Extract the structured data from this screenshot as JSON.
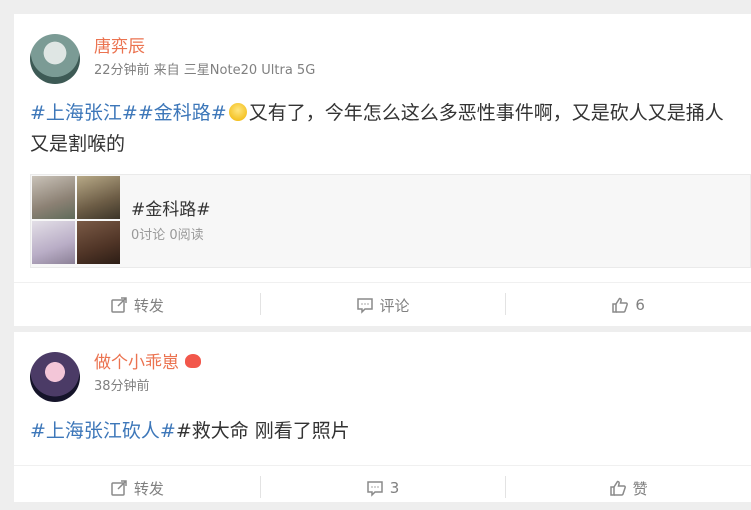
{
  "posts": [
    {
      "username": "唐弈辰",
      "meta": "22分钟前 来自 三星Note20 Ultra 5G",
      "text_parts": [
        "#上海张江#",
        "#金科路#",
        "又有了，今年怎么这么多恶性事件啊，又是砍人又是捅人又是割喉的"
      ],
      "emoji": "smile-emoji",
      "topic_card": {
        "title": "#金科路#",
        "stats": "0讨论 0阅读"
      },
      "actions": {
        "repost": "转发",
        "comment": "评论",
        "like": "6"
      }
    },
    {
      "username": "做个小乖崽",
      "meta": "38分钟前",
      "text_parts": [
        "#上海张江砍人#",
        "#救大命",
        " 刚看了照片"
      ],
      "actions": {
        "repost": "转发",
        "comment": "3",
        "like": "赞"
      }
    }
  ],
  "icons": {
    "repost": "share-icon",
    "comment": "comment-icon",
    "like": "thumbs-up-icon"
  },
  "colors": {
    "username": "#eb7350",
    "topic_link": "#3d77b9",
    "meta": "#808080",
    "background": "#eeeeee"
  }
}
